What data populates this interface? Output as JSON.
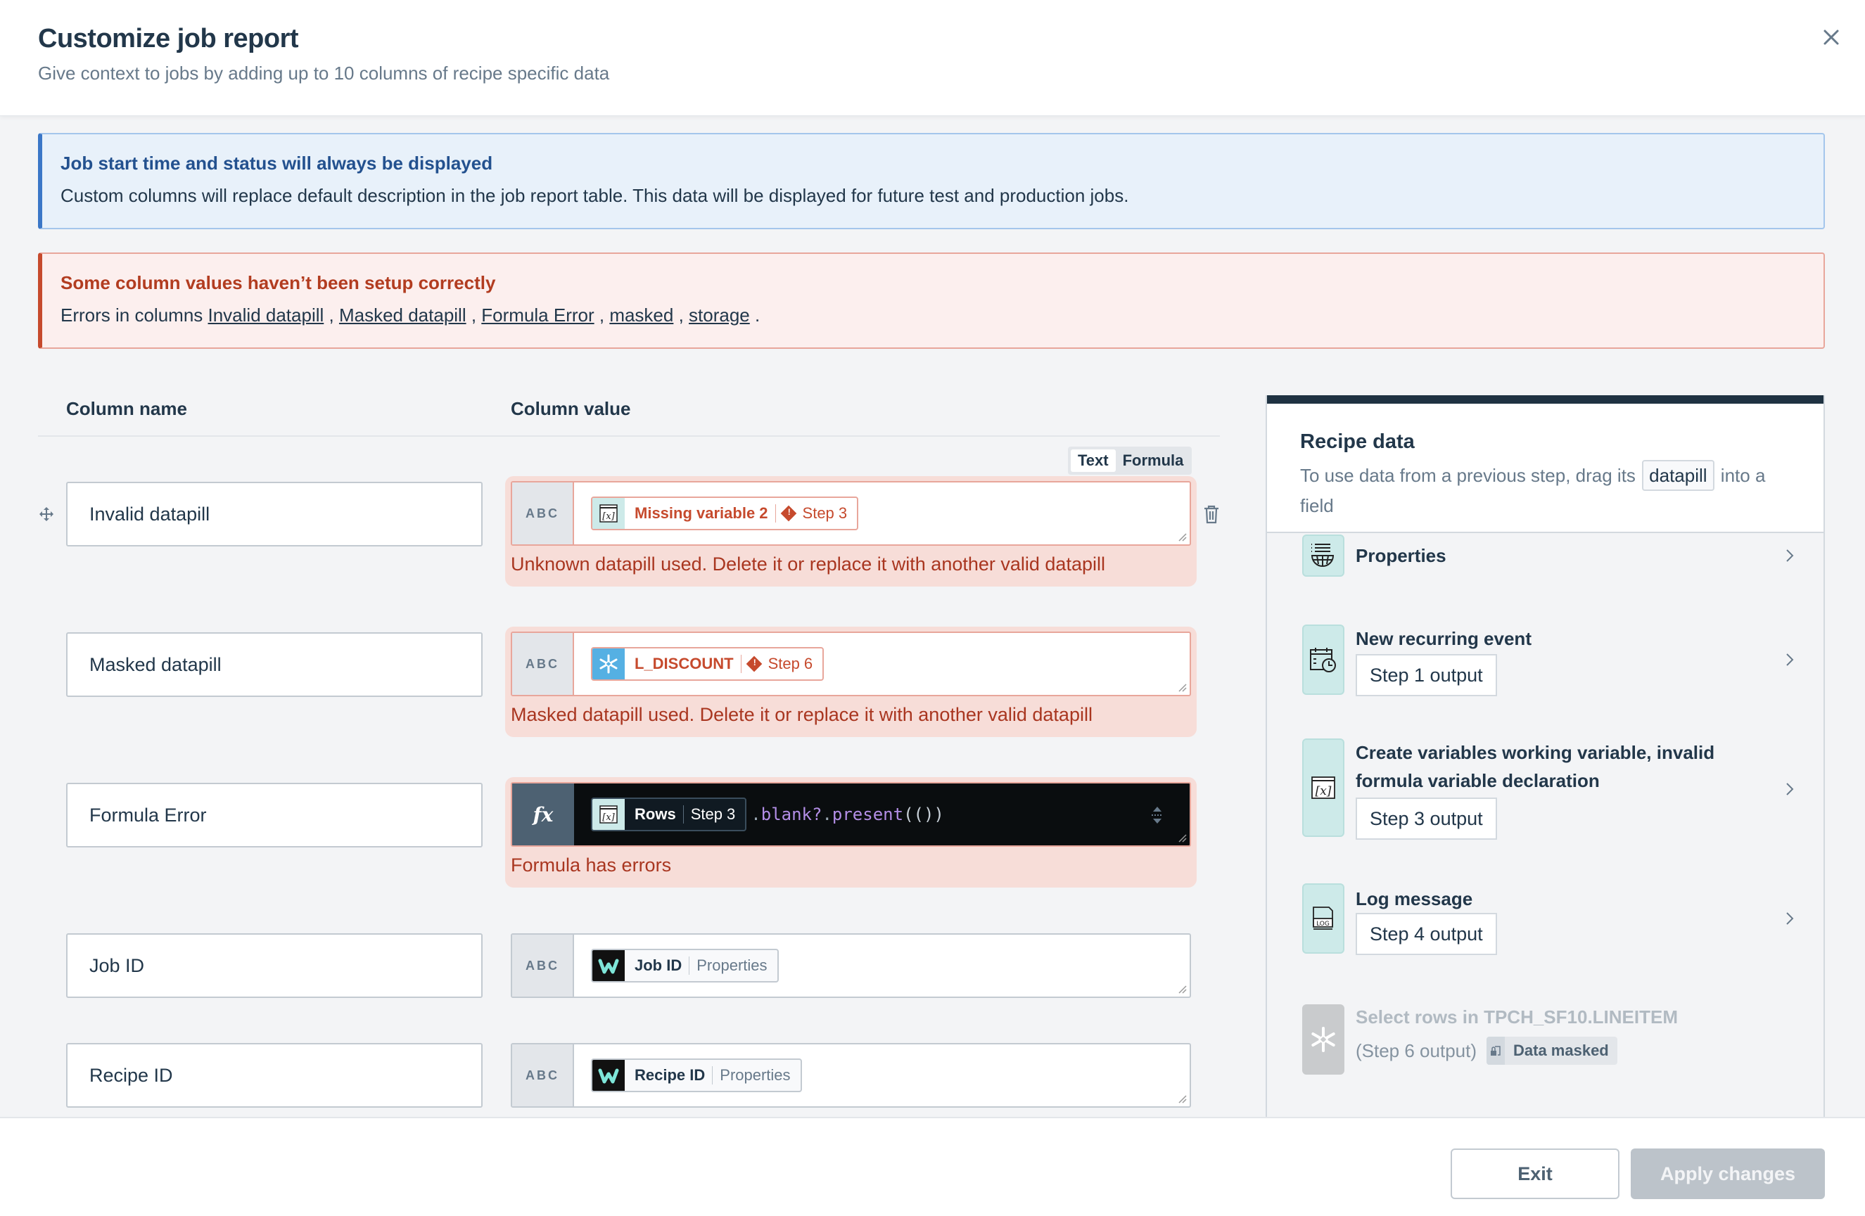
{
  "header": {
    "title": "Customize job report",
    "subtitle": "Give context to jobs by adding up to 10 columns of recipe specific data"
  },
  "info_alert": {
    "title": "Job start time and status will always be displayed",
    "body": "Custom columns will replace default description in the job report table. This data will be displayed for future test and production jobs."
  },
  "error_alert": {
    "title": "Some column values haven’t been setup correctly",
    "prefix": "Errors in columns ",
    "links": [
      "Invalid datapill",
      "Masked datapill",
      "Formula Error",
      "masked",
      "storage"
    ],
    "separator": " , ",
    "suffix": " ."
  },
  "columns": {
    "name_header": "Column name",
    "value_header": "Column value"
  },
  "toggle": {
    "options": [
      "Text",
      "Formula"
    ],
    "active": "Text"
  },
  "rows": [
    {
      "name": "Invalid datapill",
      "type": "ABC",
      "pill": {
        "icon": "variable-icon",
        "name": "Missing variable 2",
        "source": "Step 3",
        "status": "error"
      },
      "error": "Unknown datapill used. Delete it or replace it with another valid datapill"
    },
    {
      "name": "Masked datapill",
      "type": "ABC",
      "pill": {
        "icon": "snowflake-icon",
        "name": "L_DISCOUNT",
        "source": "Step 6",
        "status": "error"
      },
      "error": "Masked datapill used. Delete it or replace it with another valid datapill"
    },
    {
      "name": "Formula Error",
      "type": "fx",
      "pill": {
        "icon": "variable-icon",
        "name": "Rows",
        "source": "Step 3",
        "status": "formula"
      },
      "formula_tail": {
        "dot1": ".",
        "fn1": "blank?",
        "dot2": ".",
        "fn2": "present",
        "parens": "(())"
      },
      "error": "Formula has errors"
    },
    {
      "name": "Job ID",
      "type": "ABC",
      "pill": {
        "icon": "workato-icon",
        "name": "Job ID",
        "source": "Properties",
        "status": "ok"
      }
    },
    {
      "name": "Recipe ID",
      "type": "ABC",
      "pill": {
        "icon": "workato-icon",
        "name": "Recipe ID",
        "source": "Properties",
        "status": "ok"
      }
    }
  ],
  "recipe_panel": {
    "title": "Recipe data",
    "desc_before": "To use data from a previous step, drag its",
    "desc_pill": "datapill",
    "desc_after": "into a field",
    "steps": [
      {
        "icon": "properties-icon",
        "title": "Properties"
      },
      {
        "icon": "calendar-clock-icon",
        "title": "New recurring event",
        "output": "Step 1 output"
      },
      {
        "icon": "variable-icon",
        "title": "Create variables working variable, invalid formula variable declaration",
        "output": "Step 3 output"
      },
      {
        "icon": "log-icon",
        "title": "Log message",
        "output": "Step 4 output"
      },
      {
        "icon": "snowflake-icon",
        "title": "Select rows in TPCH_SF10.LINEITEM",
        "output": "(Step 6 output)",
        "badge": "Data masked",
        "disabled": true
      }
    ]
  },
  "footer": {
    "exit_label": "Exit",
    "apply_label": "Apply changes"
  },
  "colors": {
    "primary_text": "#22374a",
    "info_accent": "#3b77c7",
    "error_accent": "#c64a2d",
    "pill_teal": "#cdeae9",
    "apply_disabled": "#bcc3ca"
  }
}
